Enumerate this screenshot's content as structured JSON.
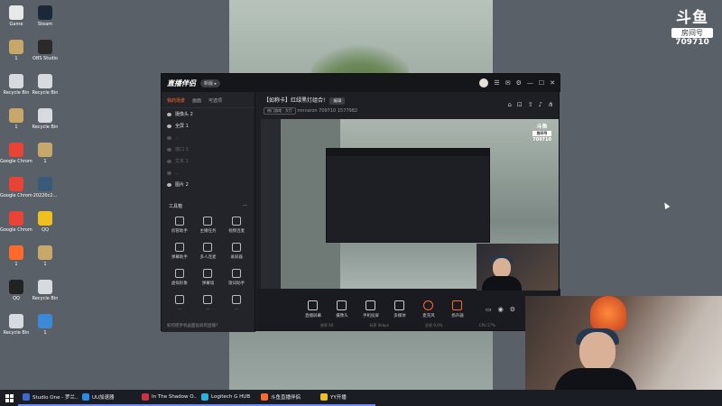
{
  "desktop": {
    "icons": [
      {
        "label": "Game",
        "color": "#e8e8e8"
      },
      {
        "label": "Steam",
        "color": "#1b2838"
      },
      {
        "label": "1",
        "color": "#c8a86a"
      },
      {
        "label": "OBS Studio",
        "color": "#2a2a2a"
      },
      {
        "label": "Recycle Bin",
        "color": "#d7dbe0"
      },
      {
        "label": "Recycle Bin",
        "color": "#d7dbe0"
      },
      {
        "label": "1",
        "color": "#c8a86a"
      },
      {
        "label": "Recycle Bin",
        "color": "#d7dbe0"
      },
      {
        "label": "Google Chrome",
        "color": "#e84335"
      },
      {
        "label": "1",
        "color": "#c8a86a"
      },
      {
        "label": "Google Chrome",
        "color": "#e84335"
      },
      {
        "label": "20220c2...",
        "color": "#3a5a7a"
      },
      {
        "label": "Google Chrome",
        "color": "#e84335"
      },
      {
        "label": "QQ",
        "color": "#f0c020"
      },
      {
        "label": "1",
        "color": "#ff6a2a"
      },
      {
        "label": "1",
        "color": "#c8a86a"
      },
      {
        "label": "QQ",
        "color": "#222"
      },
      {
        "label": "Recycle Bin",
        "color": "#d7dbe0"
      },
      {
        "label": "Recycle Bin",
        "color": "#d7dbe0"
      },
      {
        "label": "1",
        "color": "#3a8ad8"
      }
    ]
  },
  "douyu_badge": {
    "logo": "斗鱼",
    "room_label": "房间号",
    "room_number": "709710"
  },
  "app": {
    "title": "直播伴侣",
    "version": "新版 ▸",
    "left_tabs": [
      "我的场景",
      "画面",
      "可选项"
    ],
    "sources": [
      {
        "label": "摄像头 2",
        "dim": false
      },
      {
        "label": "全屏 1",
        "dim": false
      },
      {
        "label": "...",
        "dim": true
      },
      {
        "label": "窗口 1",
        "dim": true
      },
      {
        "label": "文本 1",
        "dim": true
      },
      {
        "label": "...",
        "dim": true
      },
      {
        "label": "图片 2",
        "dim": false
      }
    ],
    "tools_header": "工具箱",
    "tools": [
      "房管助手",
      "主播任务",
      "视频连麦",
      "弹幕助手",
      "多人连麦",
      "录屏器",
      "虚拟形象",
      "弹幕墙",
      "歌词助手",
      "...",
      "...",
      "..."
    ],
    "footer_hint": "如何把手机画面投屏到直播?",
    "room": {
      "title": "【如称卡】红绿黑灯组合!",
      "edit": "编辑",
      "tag": "热门游戏 · 大厅",
      "streamer": "mnnarzn",
      "room_no": "709710",
      "heat": "1577982"
    },
    "preview_badge": {
      "logo": "斗鱼",
      "room_label": "房间号",
      "room_number": "709710"
    },
    "bottom": [
      {
        "label": "直播屏幕",
        "kind": "normal"
      },
      {
        "label": "摄像头",
        "kind": "normal"
      },
      {
        "label": "手机投屏",
        "kind": "normal"
      },
      {
        "label": "多媒体",
        "kind": "normal"
      },
      {
        "label": "麦克风",
        "kind": "mic"
      },
      {
        "label": "扬声器",
        "kind": "spk"
      }
    ],
    "stats": [
      "帧率 60",
      "码率 0kbps",
      "丢帧 0.0%",
      "CPU 27%"
    ]
  },
  "taskbar": {
    "items": [
      {
        "label": "Studio One - 罗兰...",
        "color": "#3a6ad0"
      },
      {
        "label": "UU加速器",
        "color": "#2a8ae8"
      },
      {
        "label": "In The Shadow O...",
        "color": "#d03040"
      },
      {
        "label": "Logitech G HUB",
        "color": "#2bb0e0"
      },
      {
        "label": "斗鱼直播伴侣",
        "color": "#ff6a2a"
      },
      {
        "label": "YY开播",
        "color": "#f0c020"
      }
    ]
  }
}
